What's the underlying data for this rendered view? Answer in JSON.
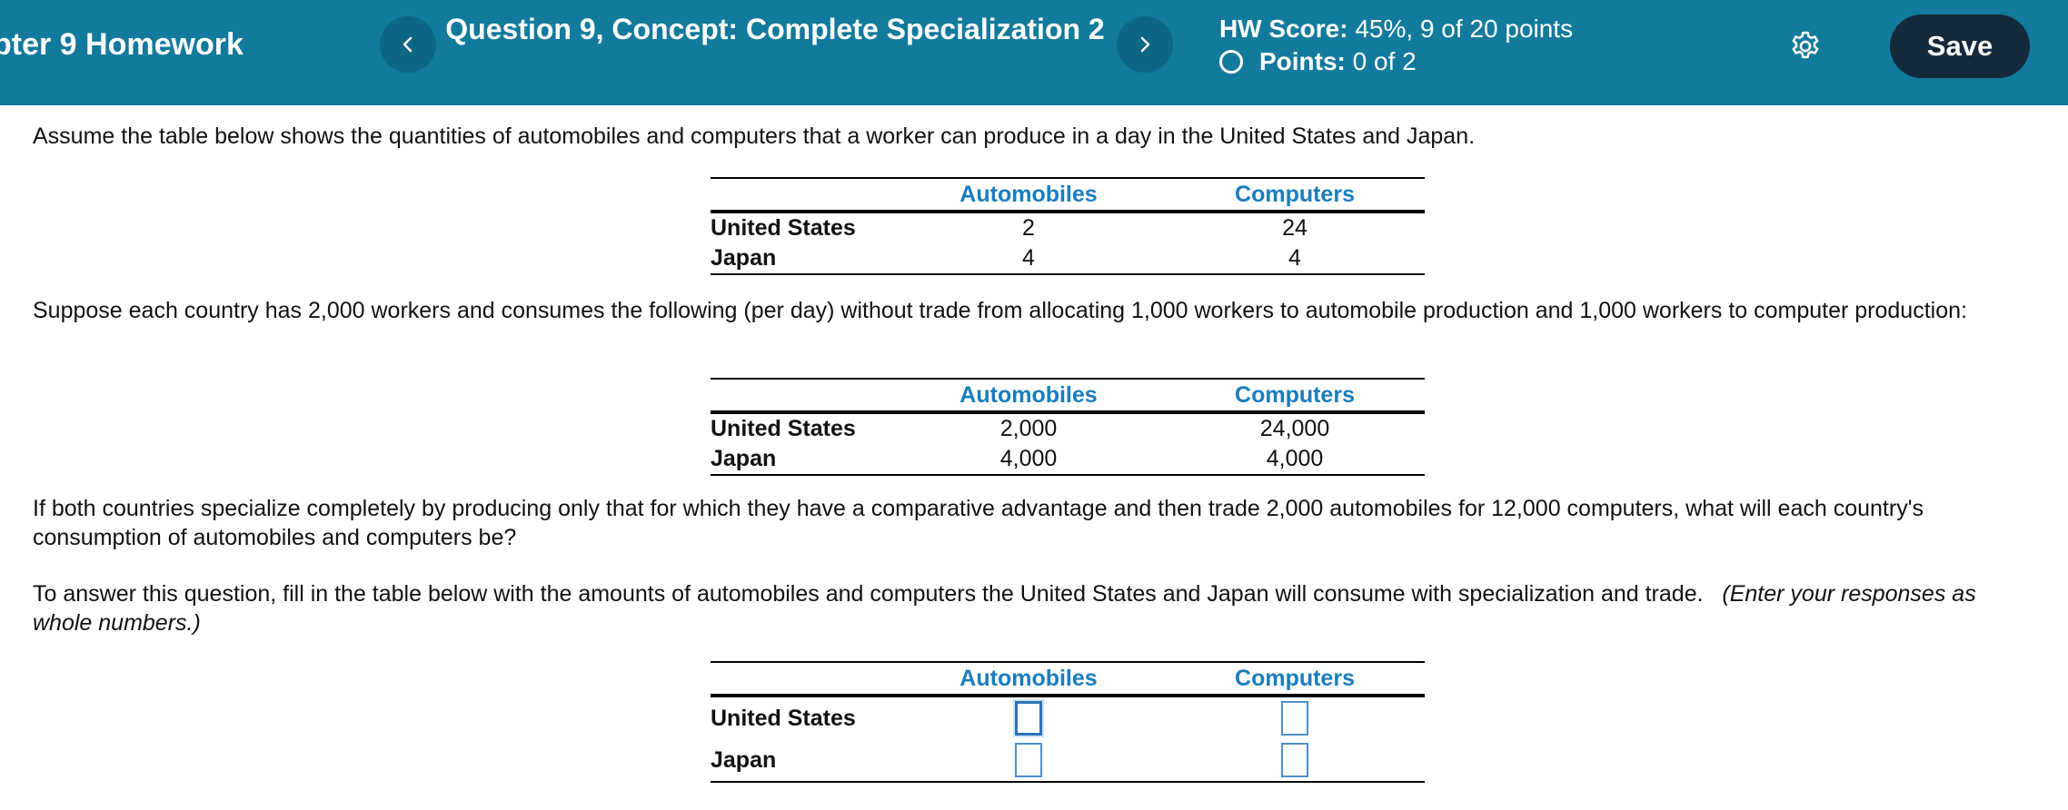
{
  "header": {
    "hw_title": "pter 9 Homework",
    "question_title": "Question 9, Concept: Complete Specialization 2",
    "hw_score_label": "HW Score:",
    "hw_score_value": "45%, 9 of 20 points",
    "points_label": "Points:",
    "points_value": "0 of 2",
    "prev_icon": "chevron-left-icon",
    "next_icon": "chevron-right-icon",
    "settings_icon": "gear-icon",
    "save_label": "Save"
  },
  "colors": {
    "header_bg": "#127a9c",
    "save_bg": "#14293a",
    "table_header_text": "#1a7dbd"
  },
  "question": {
    "intro": "Assume the table below shows the quantities of automobiles and computers that a worker can produce in a day in the United States and Japan.",
    "table1": {
      "headers": [
        "Automobiles",
        "Computers"
      ],
      "rows": [
        {
          "country": "United States",
          "automobiles": "2",
          "computers": "24"
        },
        {
          "country": "Japan",
          "automobiles": "4",
          "computers": "4"
        }
      ]
    },
    "para2": "Suppose each country has 2,000 workers and consumes the following (per day) without trade from allocating 1,000 workers to automobile production and 1,000 workers to computer production:",
    "table2": {
      "headers": [
        "Automobiles",
        "Computers"
      ],
      "rows": [
        {
          "country": "United States",
          "automobiles": "2,000",
          "computers": "24,000"
        },
        {
          "country": "Japan",
          "automobiles": "4,000",
          "computers": "4,000"
        }
      ]
    },
    "para3": "If both countries specialize completely by producing only that for which they have a comparative advantage and then trade 2,000 automobiles for 12,000 computers, what will each country's consumption of automobiles and computers be?",
    "para4": "To answer this question, fill in the table below with the amounts of automobiles and computers the United States and Japan will consume with specialization and trade.",
    "para4_note": "(Enter your responses as whole numbers.)",
    "answer_table": {
      "headers": [
        "Automobiles",
        "Computers"
      ],
      "rows": [
        {
          "country": "United States",
          "automobiles": "",
          "computers": ""
        },
        {
          "country": "Japan",
          "automobiles": "",
          "computers": ""
        }
      ]
    }
  }
}
